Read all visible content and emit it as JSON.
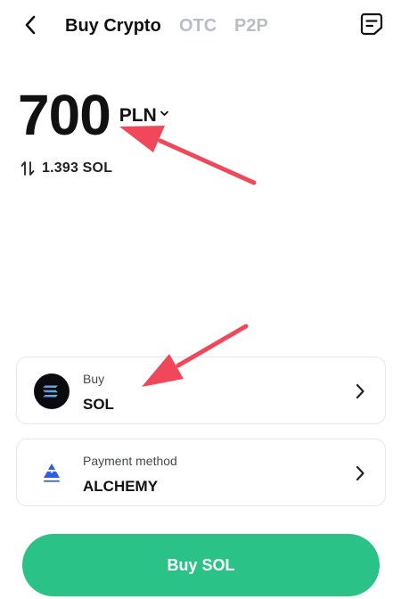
{
  "header": {
    "tabs": [
      {
        "label": "Buy Crypto",
        "active": true
      },
      {
        "label": "OTC",
        "active": false
      },
      {
        "label": "P2P",
        "active": false
      }
    ],
    "back_icon": "chevron-left-icon",
    "orders_icon": "orders-list-icon"
  },
  "amount": {
    "value": "700",
    "currency": "PLN",
    "converted": "1.393 SOL",
    "convert_icon": "swap-vertical-icon"
  },
  "buy_card": {
    "label": "Buy",
    "value": "SOL",
    "icon": "solana-logo-icon"
  },
  "payment_card": {
    "label": "Payment method",
    "value": "ALCHEMY",
    "icon": "alchemy-pay-logo-icon"
  },
  "buy_button": {
    "label": "Buy SOL"
  },
  "colors": {
    "accent": "#2bc287",
    "inactive_tab": "#b9bdc4",
    "annotation_arrow": "#f0485a"
  }
}
